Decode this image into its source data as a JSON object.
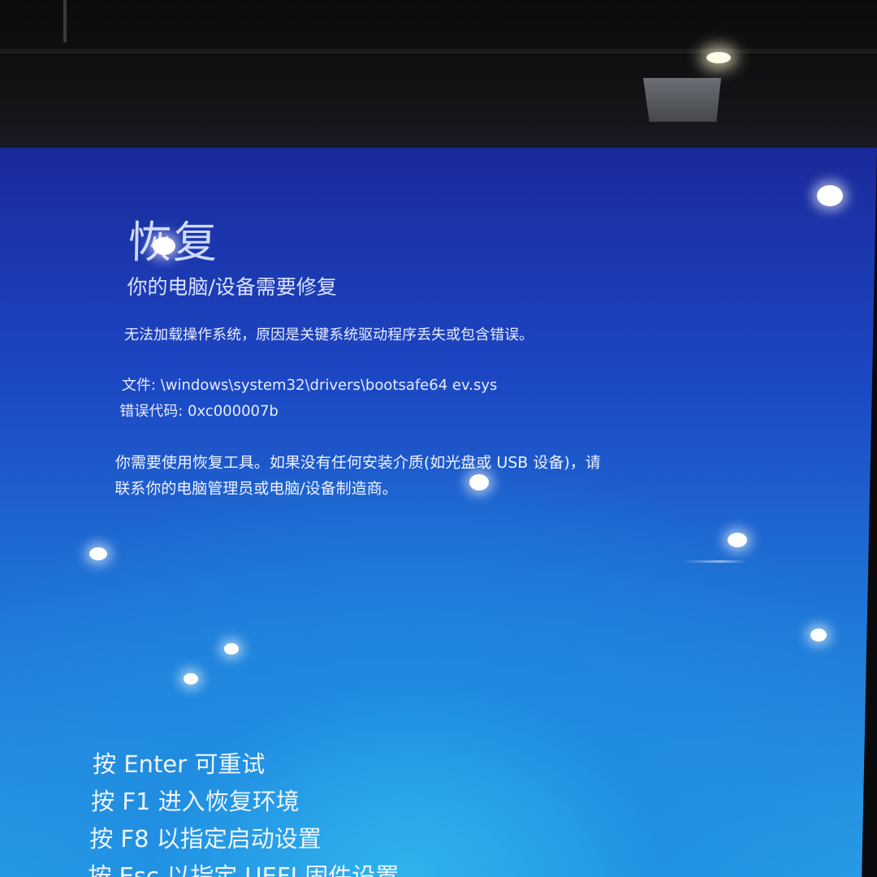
{
  "recovery": {
    "title": "恢复",
    "subtitle": "你的电脑/设备需要修复",
    "message": "无法加载操作系统，原因是关键系统驱动程序丢失或包含错误。",
    "file_label": "文件:",
    "file_path": "\\windows\\system32\\drivers\\bootsafe64 ev.sys",
    "error_label": "错误代码:",
    "error_code": "0xc000007b",
    "help_text": "你需要使用恢复工具。如果没有任何安装介质(如光盘或 USB 设备)，请联系你的电脑管理员或电脑/设备制造商。"
  },
  "key_options": [
    {
      "label": "按 Enter 可重试"
    },
    {
      "label": "按 F1 进入恢复环境"
    },
    {
      "label": "按 F8 以指定启动设置"
    },
    {
      "label": "按 Esc 以指定 UEFI 固件设置"
    }
  ],
  "colors": {
    "screen_top": "#1a2a9a",
    "screen_mid": "#1f78d8",
    "screen_bottom": "#2a9fe6",
    "text": "#e7ecff"
  }
}
